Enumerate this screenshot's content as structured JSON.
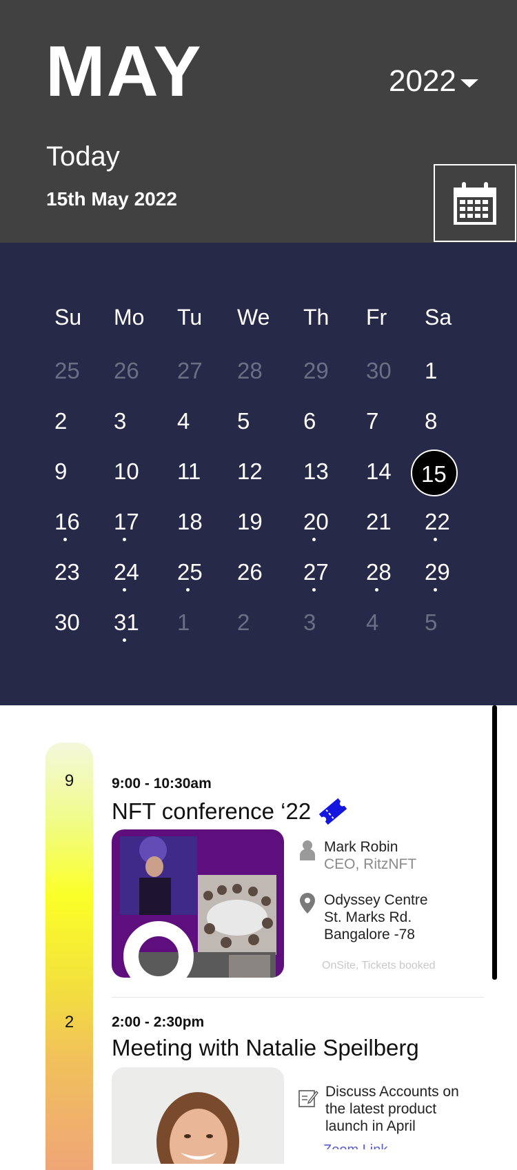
{
  "header": {
    "month": "MAY",
    "year": "2022",
    "today_label": "Today",
    "today_date": "15th May 2022",
    "calendar_icon": "calendar-icon"
  },
  "calendar": {
    "weekdays": [
      "Su",
      "Mo",
      "Tu",
      "We",
      "Th",
      "Fr",
      "Sa"
    ],
    "weeks": [
      [
        {
          "d": "25",
          "other": true
        },
        {
          "d": "26",
          "other": true
        },
        {
          "d": "27",
          "other": true
        },
        {
          "d": "28",
          "other": true
        },
        {
          "d": "29",
          "other": true
        },
        {
          "d": "30",
          "other": true
        },
        {
          "d": "1"
        }
      ],
      [
        {
          "d": "2"
        },
        {
          "d": "3"
        },
        {
          "d": "4"
        },
        {
          "d": "5"
        },
        {
          "d": "6"
        },
        {
          "d": "7"
        },
        {
          "d": "8"
        }
      ],
      [
        {
          "d": "9"
        },
        {
          "d": "10"
        },
        {
          "d": "11"
        },
        {
          "d": "12"
        },
        {
          "d": "13"
        },
        {
          "d": "14"
        },
        {
          "d": "15",
          "selected": true
        }
      ],
      [
        {
          "d": "16",
          "dot": true
        },
        {
          "d": "17",
          "dot": true
        },
        {
          "d": "18"
        },
        {
          "d": "19"
        },
        {
          "d": "20",
          "dot": true
        },
        {
          "d": "21"
        },
        {
          "d": "22",
          "dot": true
        }
      ],
      [
        {
          "d": "23"
        },
        {
          "d": "24",
          "dot": true
        },
        {
          "d": "25",
          "dot": true
        },
        {
          "d": "26"
        },
        {
          "d": "27",
          "dot": true
        },
        {
          "d": "28",
          "dot": true
        },
        {
          "d": "29",
          "dot": true
        }
      ],
      [
        {
          "d": "30"
        },
        {
          "d": "31",
          "dot": true
        },
        {
          "d": "1",
          "other": true
        },
        {
          "d": "2",
          "other": true
        },
        {
          "d": "3",
          "other": true
        },
        {
          "d": "4",
          "other": true
        },
        {
          "d": "5",
          "other": true
        }
      ]
    ],
    "colors": {
      "background": "#262a48",
      "selected": "#000000"
    }
  },
  "events": [
    {
      "hour": "9",
      "time": "9:00 - 10:30am",
      "title": "NFT conference ‘22",
      "icon": "ticket-icon",
      "person_name": "Mark Robin",
      "person_role": "CEO, RitzNFT",
      "location": [
        "Odyssey Centre",
        "St. Marks Rd.",
        "Bangalore -78"
      ],
      "status": "OnSite, Tickets booked"
    },
    {
      "hour": "2",
      "time": "2:00 - 2:30pm",
      "title": "Meeting with Natalie Speilberg",
      "note": [
        "Discuss Accounts on",
        "the latest product",
        "launch in April"
      ],
      "link": "Zoom Link"
    }
  ]
}
